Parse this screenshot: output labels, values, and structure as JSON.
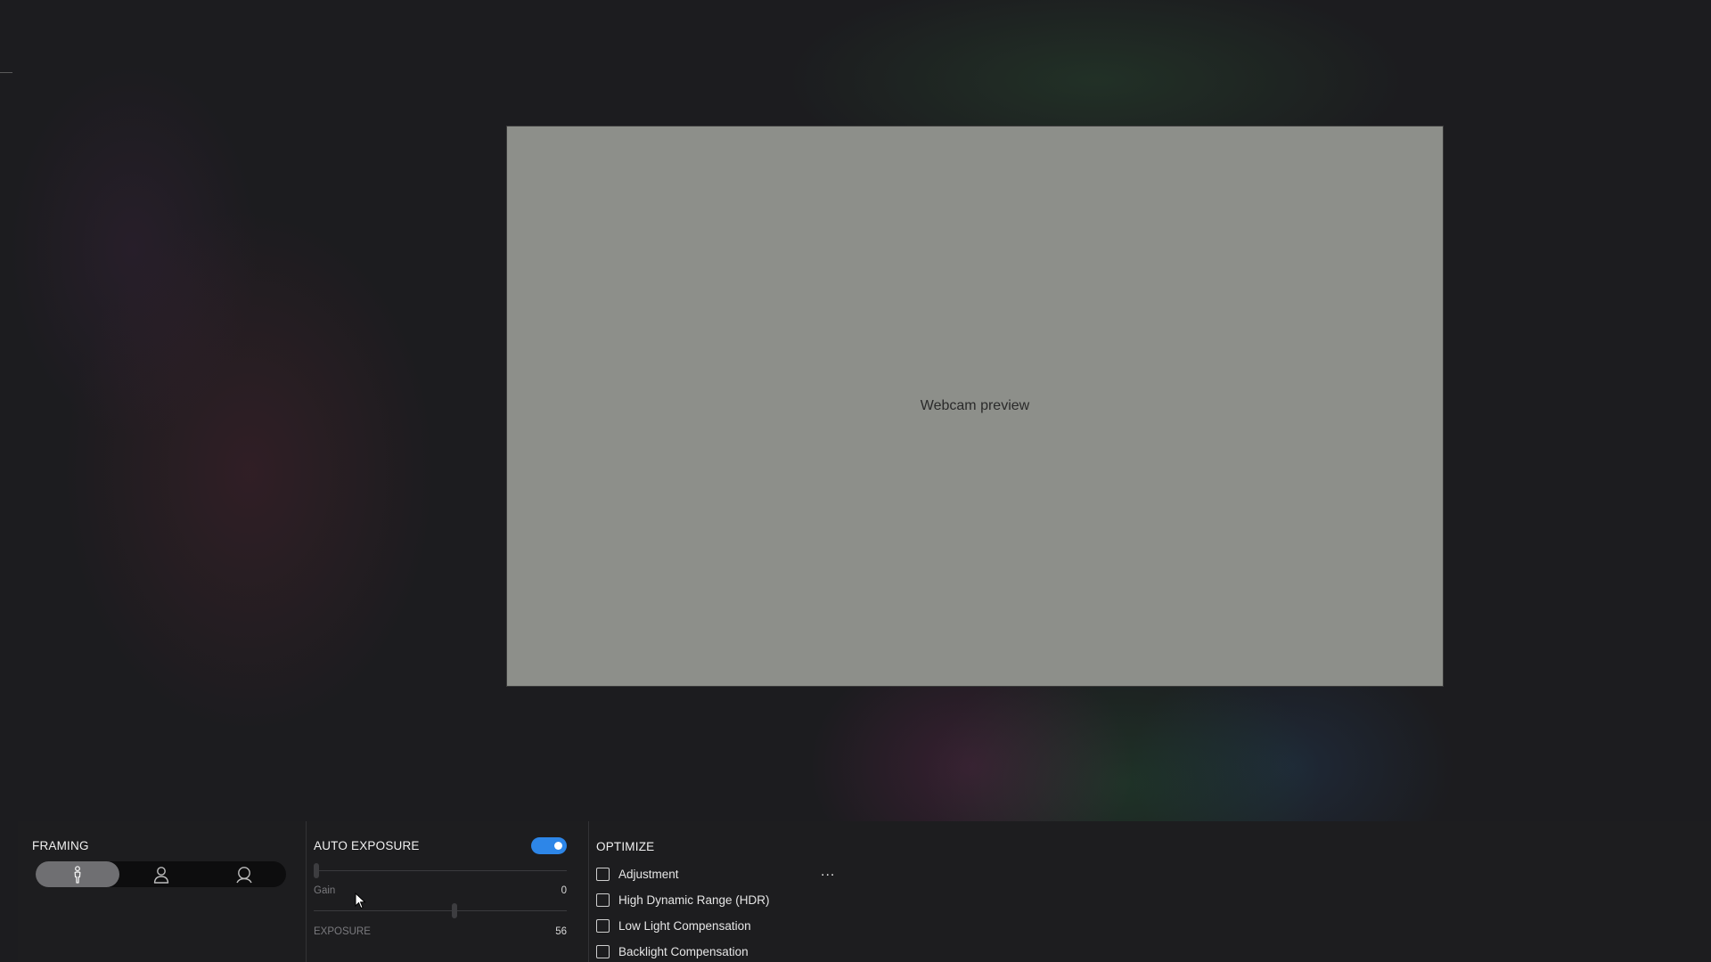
{
  "preview": {
    "image_alt": "Webcam preview"
  },
  "framing": {
    "title": "FRAMING",
    "modes": [
      {
        "icon": "full-body-icon",
        "active": true
      },
      {
        "icon": "upper-body-icon",
        "active": false
      },
      {
        "icon": "head-icon",
        "active": false
      }
    ]
  },
  "auto_exposure": {
    "title": "AUTO EXPOSURE",
    "enabled": true,
    "gain": {
      "label": "Gain",
      "value": "0"
    },
    "exposure": {
      "label": "EXPOSURE",
      "value": "56"
    }
  },
  "optimize": {
    "title": "OPTIMIZE",
    "more_label": "...",
    "items": [
      {
        "label": "Adjustment",
        "checked": false
      },
      {
        "label": "High Dynamic Range (HDR)",
        "checked": false
      },
      {
        "label": "Low Light Compensation",
        "checked": false
      },
      {
        "label": "Backlight Compensation",
        "checked": false
      }
    ]
  },
  "colors": {
    "accent": "#2d86e8",
    "panel": "#1d1d1f",
    "segment_active": "#6f6f72"
  }
}
